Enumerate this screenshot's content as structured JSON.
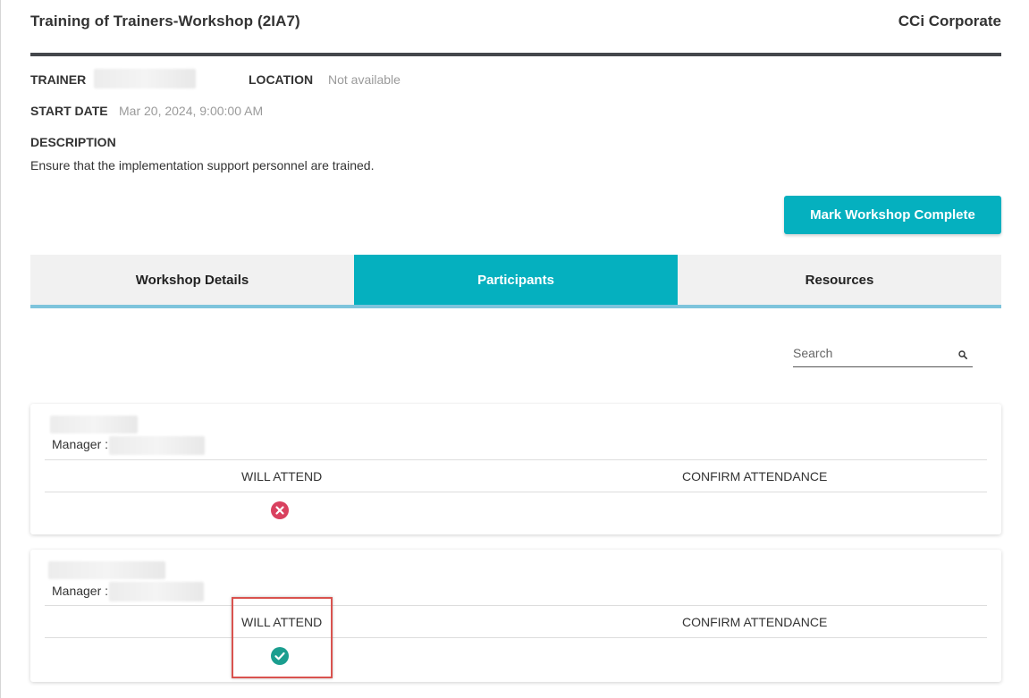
{
  "header": {
    "title": "Training of Trainers-Workshop (2IA7)",
    "organization": "CCi Corporate"
  },
  "details": {
    "trainer_label": "TRAINER",
    "location_label": "LOCATION",
    "location_value": "Not available",
    "start_date_label": "START DATE",
    "start_date_value": "Mar 20, 2024, 9:00:00 AM",
    "description_label": "DESCRIPTION",
    "description_value": "Ensure that the implementation support personnel are trained."
  },
  "actions": {
    "mark_complete_label": "Mark Workshop Complete"
  },
  "tabs": [
    {
      "label": "Workshop Details",
      "active": false
    },
    {
      "label": "Participants",
      "active": true
    },
    {
      "label": "Resources",
      "active": false
    }
  ],
  "search": {
    "placeholder": "Search"
  },
  "participants": [
    {
      "manager_label": "Manager :",
      "will_attend_header": "WILL ATTEND",
      "confirm_attendance_header": "CONFIRM ATTENDANCE",
      "will_attend": false,
      "status_icon": "x-circle-icon"
    },
    {
      "manager_label": "Manager :",
      "will_attend_header": "WILL ATTEND",
      "confirm_attendance_header": "CONFIRM ATTENDANCE",
      "will_attend": true,
      "status_icon": "check-circle-icon"
    }
  ],
  "colors": {
    "accent": "#05b0bf",
    "tab_underline": "#7ec4dc",
    "decline": "#d9415f",
    "accept": "#1a9e8f",
    "highlight": "#d9534f"
  }
}
